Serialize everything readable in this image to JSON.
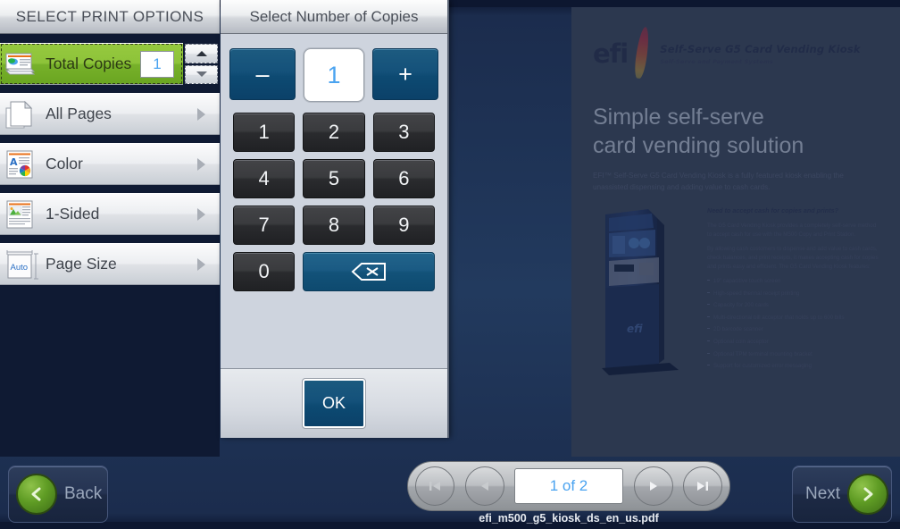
{
  "left_panel": {
    "title": "SELECT PRINT OPTIONS",
    "items": [
      {
        "label": "Total Copies",
        "icon": "copies-icon",
        "selected": true,
        "value": "1",
        "has_arrow": false
      },
      {
        "label": "All Pages",
        "icon": "page-icon",
        "selected": false,
        "has_arrow": true
      },
      {
        "label": "Color",
        "icon": "color-icon",
        "selected": false,
        "has_arrow": true
      },
      {
        "label": "1-Sided",
        "icon": "sided-icon",
        "selected": false,
        "has_arrow": true
      },
      {
        "label": "Page Size",
        "icon": "page-size-icon",
        "icon_text": "Auto",
        "selected": false,
        "has_arrow": true
      }
    ],
    "spinner": {
      "up": "stepper-up-icon",
      "down": "stepper-down-icon"
    }
  },
  "dialog": {
    "title": "Select Number of Copies",
    "minus_label": "–",
    "plus_label": "+",
    "value": "1",
    "keys": [
      "1",
      "2",
      "3",
      "4",
      "5",
      "6",
      "7",
      "8",
      "9",
      "0"
    ],
    "backspace_label": "backspace-icon",
    "ok_label": "OK"
  },
  "document": {
    "logo_word": "efi",
    "logo_title": "Self-Serve G5 Card Vending Kiosk",
    "logo_subtitle": "Self-Serve and Payment Systems",
    "heading_line1": "Simple self-serve",
    "heading_line2": "card vending solution",
    "subhead": "EFI™ Self-Serve G5 Card Vending Kiosk is a fully featured kiosk enabling the unassisted dispensing and adding value to cash cards.",
    "column_heading": "Need to accept cash for copies and prints?",
    "column_p1": "The G5 Card Vending Kiosk provides a completely self-serve method to accept cash for use with the M500 Copy and Print Station.",
    "column_p2": "By allowing cash customers to dispense and add value to cash cards, check balances, and print receipts, it makes accepting cash for copies and prints easy and efficient. The G5 Card Vending Kiosk features:",
    "bullets": [
      "19\" capacitive touch screen",
      "High-speed thermal receipt printing",
      "Capacity for 200 cards",
      "Multi-directional bill acceptor that holds up to 600 bills",
      "2D barcode scanner",
      "Optional coin acceptor",
      "Optional TPM terminal mounting bracket",
      "Support for customized error messaging"
    ],
    "kiosk_brand": "efi"
  },
  "pager": {
    "first_label": "first-page-icon",
    "prev_label": "previous-page-icon",
    "page_text": "1 of 2",
    "next_label": "next-page-icon",
    "last_label": "last-page-icon",
    "filename": "efi_m500_g5_kiosk_ds_en_us.pdf"
  },
  "nav": {
    "back_label": "Back",
    "next_label": "Next",
    "back_icon": "chevron-left-icon",
    "next_icon": "chevron-right-icon"
  },
  "colors": {
    "accent_green": "#8dc339",
    "accent_blue": "#14517a",
    "value_blue": "#4aa3f0",
    "background_navy": "#223a5e",
    "panel_navy": "#0f1a33"
  }
}
